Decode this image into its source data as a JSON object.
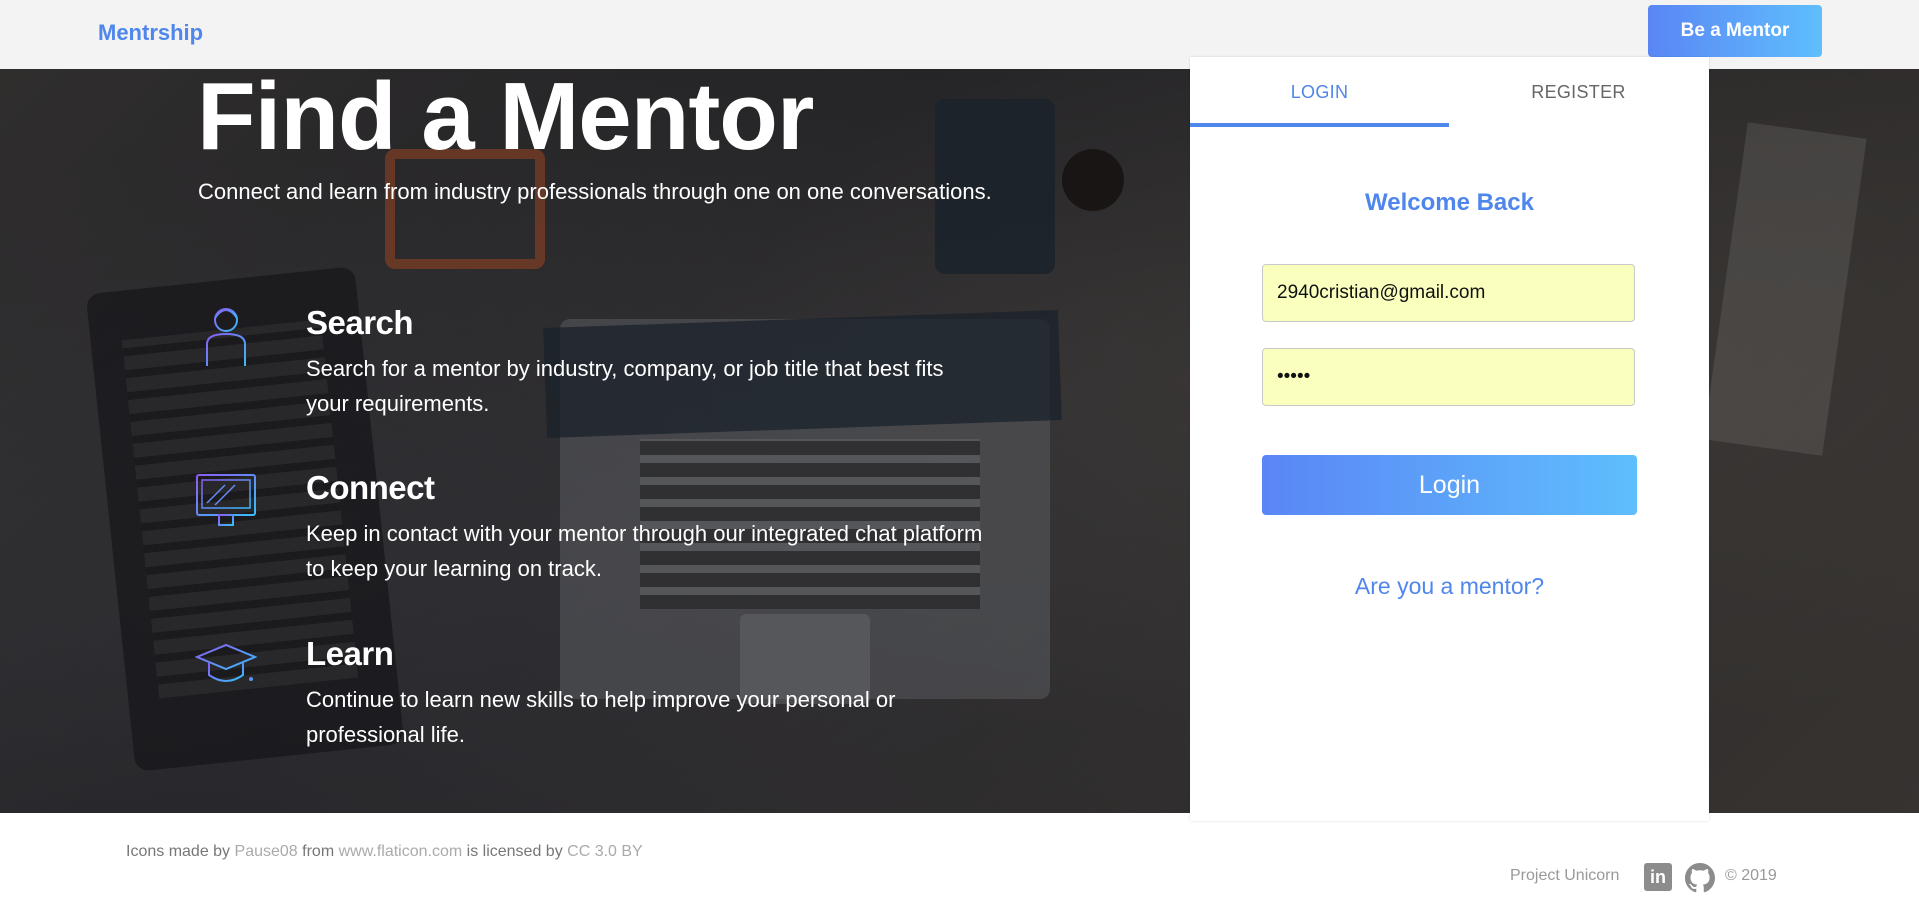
{
  "header": {
    "brand": "Mentrship",
    "be_mentor_label": "Be a Mentor"
  },
  "hero": {
    "title": "Find a Mentor",
    "subtitle": "Connect and learn from industry professionals through one on one conversations.",
    "features": [
      {
        "icon": "person-icon",
        "title": "Search",
        "description": "Search for a mentor by industry, company, or job title that best fits your requirements."
      },
      {
        "icon": "monitor-icon",
        "title": "Connect",
        "description": "Keep in contact with your mentor through our integrated chat platform to keep your learning on track."
      },
      {
        "icon": "graduation-cap-icon",
        "title": "Learn",
        "description": "Continue to learn new skills to help improve your personal or professional life."
      }
    ]
  },
  "login_card": {
    "tabs": [
      "LOGIN",
      "REGISTER"
    ],
    "active_tab": "LOGIN",
    "welcome": "Welcome Back",
    "email_value": "2940cristian@gmail.com",
    "password_value": "•••••",
    "login_label": "Login",
    "mentor_link": "Are you a mentor?"
  },
  "footer": {
    "credits_prefix": "Icons made by",
    "credits_author": "Pause08",
    "credits_from": "from",
    "credits_site": "www.flaticon.com",
    "credits_licensed": "is licensed by",
    "credits_license": "CC 3.0 BY",
    "project": "Project Unicorn",
    "linkedin_glyph": "in",
    "copyright": "© 2019"
  },
  "colors": {
    "accent": "#4f86ec",
    "gradient_start": "#5a86f5",
    "gradient_end": "#5fbefd",
    "autofill_bg": "#faffbd"
  }
}
